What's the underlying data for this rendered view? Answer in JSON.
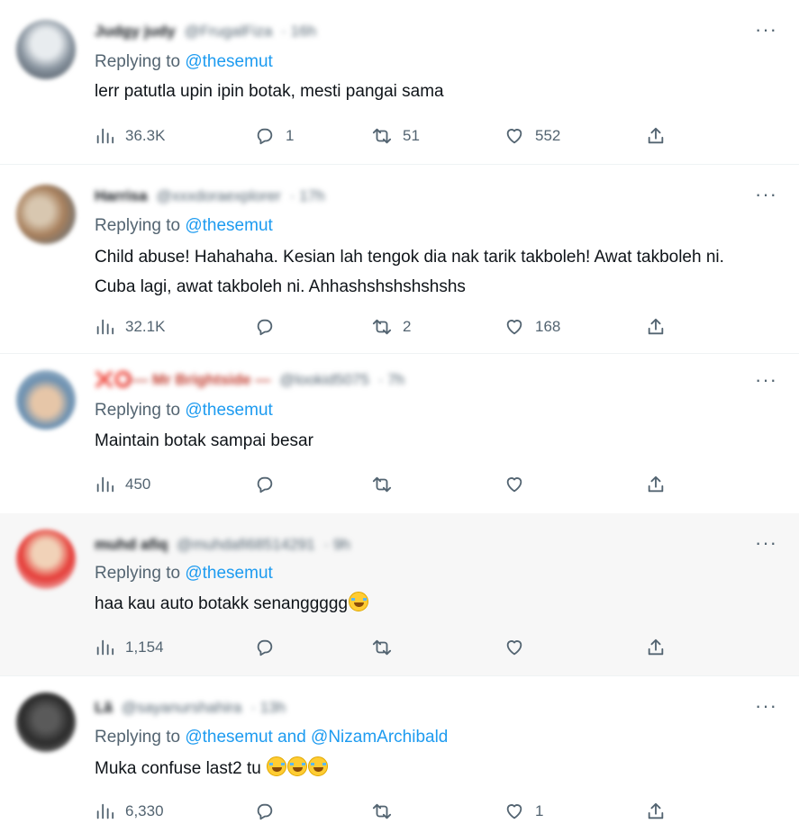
{
  "colors": {
    "link": "#1d9bf0",
    "muted": "#536471",
    "text": "#0f1419",
    "highlight": "#f7f7f7",
    "divider": "#eff3f4"
  },
  "icons": {
    "more": "more-horizontal-icon",
    "views": "views-bar-chart-icon",
    "reply": "reply-bubble-icon",
    "retweet": "retweet-icon",
    "like": "heart-icon",
    "share": "share-upload-icon"
  },
  "tweets": [
    {
      "name": "Judgy judy",
      "handle": "@FrugalFiza",
      "time": "· 16h",
      "more": "···",
      "replying_prefix": "Replying to ",
      "mention": "@thesemut",
      "text": "lerr patutla upin ipin botak, mesti pangai sama",
      "views": "36.3K",
      "replies": "1",
      "retweets": "51",
      "likes": "552"
    },
    {
      "name": "Harrisa",
      "handle": "@xxxdoraexplorer",
      "time": "· 17h",
      "more": "···",
      "replying_prefix": "Replying to ",
      "mention": "@thesemut",
      "text": "Child abuse! Hahahaha. Kesian lah tengok dia nak tarik takboleh! Awat takboleh ni. Cuba lagi, awat takboleh ni. Ahhashshshshshshs",
      "views": "32.1K",
      "replies": "",
      "retweets": "2",
      "likes": "168"
    },
    {
      "name": "❌⭕— Mr Brightside —",
      "handle": "@lookid5075",
      "time": "· 7h",
      "more": "···",
      "replying_prefix": "Replying to ",
      "mention": "@thesemut",
      "text": "Maintain botak sampai besar",
      "views": "450",
      "replies": "",
      "retweets": "",
      "likes": ""
    },
    {
      "name": "muhd afiq",
      "handle": "@muhdafi68514291",
      "time": "· 9h",
      "more": "···",
      "replying_prefix": "Replying to ",
      "mention": "@thesemut",
      "text": "haa kau auto botakk senanggggg",
      "emoji_count": 1,
      "views": "1,154",
      "replies": "",
      "retweets": "",
      "likes": ""
    },
    {
      "name": "Lã",
      "handle": "@sayanurshahira",
      "time": "· 13h",
      "more": "···",
      "replying_prefix": "Replying to ",
      "mention": "@thesemut and @NizamArchibald",
      "text": "Muka confuse last2 tu",
      "emoji_count": 3,
      "views": "6,330",
      "replies": "",
      "retweets": "",
      "likes": "1"
    }
  ]
}
